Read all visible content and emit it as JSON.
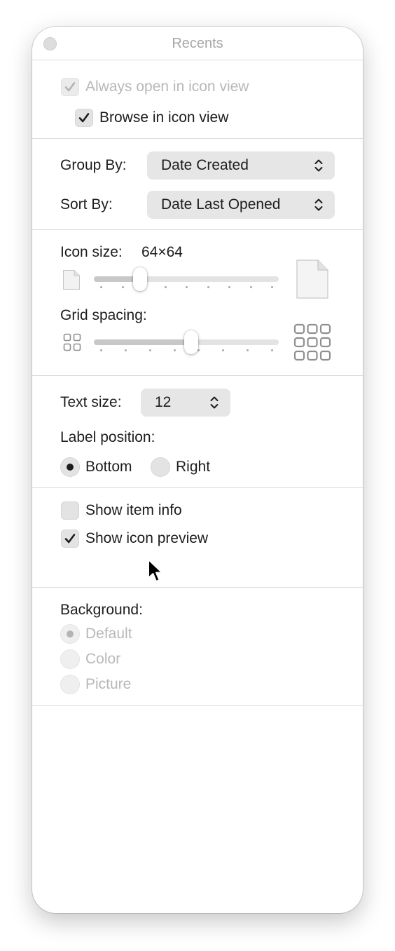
{
  "window": {
    "title": "Recents"
  },
  "view_options": {
    "always_open_icon_view": {
      "label": "Always open in icon view",
      "checked": true,
      "enabled": false
    },
    "browse_icon_view": {
      "label": "Browse in icon view",
      "checked": true,
      "enabled": true
    }
  },
  "grouping": {
    "group_by_label": "Group By:",
    "group_by_value": "Date Created",
    "sort_by_label": "Sort By:",
    "sort_by_value": "Date Last Opened"
  },
  "icon_size": {
    "label": "Icon size:",
    "value_text": "64×64",
    "slider_fraction": 0.23,
    "ticks": 9
  },
  "grid_spacing": {
    "label": "Grid spacing:",
    "slider_fraction": 0.53,
    "ticks": 8
  },
  "text_size": {
    "label": "Text size:",
    "value": "12"
  },
  "label_position": {
    "label": "Label position:",
    "options": [
      {
        "label": "Bottom",
        "selected": true
      },
      {
        "label": "Right",
        "selected": false
      }
    ]
  },
  "show_options": {
    "item_info": {
      "label": "Show item info",
      "checked": false
    },
    "icon_preview": {
      "label": "Show icon preview",
      "checked": true
    }
  },
  "background": {
    "label": "Background:",
    "options": [
      {
        "label": "Default",
        "selected": true,
        "enabled": false
      },
      {
        "label": "Color",
        "selected": false,
        "enabled": false
      },
      {
        "label": "Picture",
        "selected": false,
        "enabled": false
      }
    ]
  },
  "colors": {
    "control_fill": "#e3e3e3",
    "slider_fill": "#c8c8c8",
    "disabled_text": "#b8b8b8",
    "text": "#1d1d1f"
  }
}
